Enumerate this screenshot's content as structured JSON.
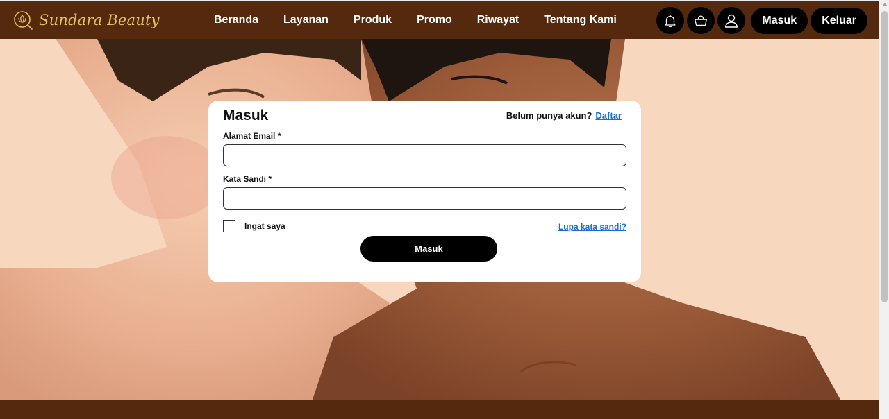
{
  "brand": {
    "name": "Sundara Beauty",
    "logo_icon": "lotus-logo-icon",
    "accent": "#e6c15a"
  },
  "header": {
    "background": "#54290e",
    "nav": [
      {
        "label": "Beranda"
      },
      {
        "label": "Layanan"
      },
      {
        "label": "Produk"
      },
      {
        "label": "Promo"
      },
      {
        "label": "Riwayat"
      },
      {
        "label": "Tentang Kami"
      }
    ],
    "icons": [
      "bell-icon",
      "basket-icon",
      "user-icon"
    ],
    "login_label": "Masuk",
    "logout_label": "Keluar"
  },
  "login_card": {
    "title": "Masuk",
    "no_account_text": "Belum punya akun?",
    "signup_link": "Daftar",
    "email_label": "Alamat Email *",
    "email_value": "",
    "password_label": "Kata Sandi *",
    "password_value": "",
    "remember_label": "Ingat saya",
    "remember_checked": false,
    "forgot_link": "Lupa kata sandi?",
    "submit_label": "Masuk",
    "link_color": "#1a6fd6"
  }
}
